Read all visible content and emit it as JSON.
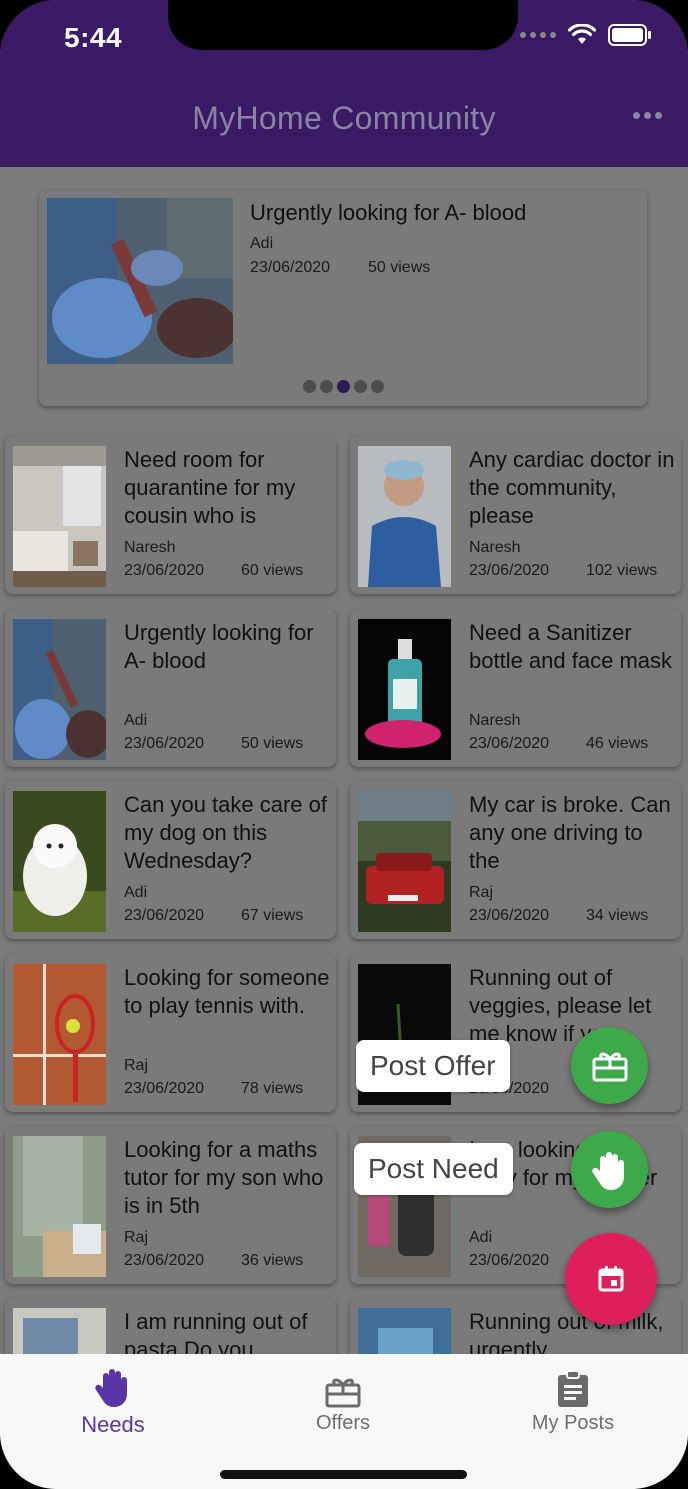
{
  "status": {
    "time": "5:44"
  },
  "header": {
    "title": "MyHome Community",
    "menu_icon": "more-horizontal-icon"
  },
  "featured": {
    "title": "Urgently looking for A- blood",
    "author": "Adi",
    "date": "23/06/2020",
    "views": "50 views",
    "carousel_dots": 5,
    "active_dot": 3
  },
  "cards": [
    {
      "title": "Need room for quarantine for my cousin who is",
      "author": "Naresh",
      "date": "23/06/2020",
      "views": "60 views"
    },
    {
      "title": "Any cardiac doctor in the community, please",
      "author": "Naresh",
      "date": "23/06/2020",
      "views": "102 views"
    },
    {
      "title": "Urgently looking for A- blood",
      "author": "Adi",
      "date": "23/06/2020",
      "views": "50 views"
    },
    {
      "title": "Need a Sanitizer bottle and face mask",
      "author": "Naresh",
      "date": "23/06/2020",
      "views": "46 views"
    },
    {
      "title": "Can you take care of my dog on this Wednesday?",
      "author": "Adi",
      "date": "23/06/2020",
      "views": "67 views"
    },
    {
      "title": "My car is broke. Can any one driving to the",
      "author": "Raj",
      "date": "23/06/2020",
      "views": "34 views"
    },
    {
      "title": "Looking for someone to play tennis with.",
      "author": "Raj",
      "date": "23/06/2020",
      "views": "78 views"
    },
    {
      "title": "Running out of veggies, please let me know if you",
      "author": "",
      "date": "23/06/2020",
      "views": "views"
    },
    {
      "title": "Looking for a maths tutor for my son who is in 5th",
      "author": "Raj",
      "date": "23/06/2020",
      "views": "36 views"
    },
    {
      "title": "I am looking for a baby for my toddler",
      "author": "Adi",
      "date": "23/06/2020",
      "views": ""
    },
    {
      "title": "I am running out of pasta Do you",
      "author": "",
      "date": "",
      "views": ""
    },
    {
      "title": "Running out of milk, urgently",
      "author": "",
      "date": "",
      "views": ""
    }
  ],
  "fab": {
    "offer_label": "Post Offer",
    "need_label": "Post Need",
    "offer_icon": "gift-icon",
    "need_icon": "hand-icon",
    "main_icon": "calendar-icon"
  },
  "nav": {
    "needs": "Needs",
    "offers": "Offers",
    "myposts": "My Posts"
  },
  "colors": {
    "header": "#3a1a64",
    "accent": "#5b35a8",
    "fab_green": "#3ea94a",
    "fab_pink": "#df1f5c"
  }
}
